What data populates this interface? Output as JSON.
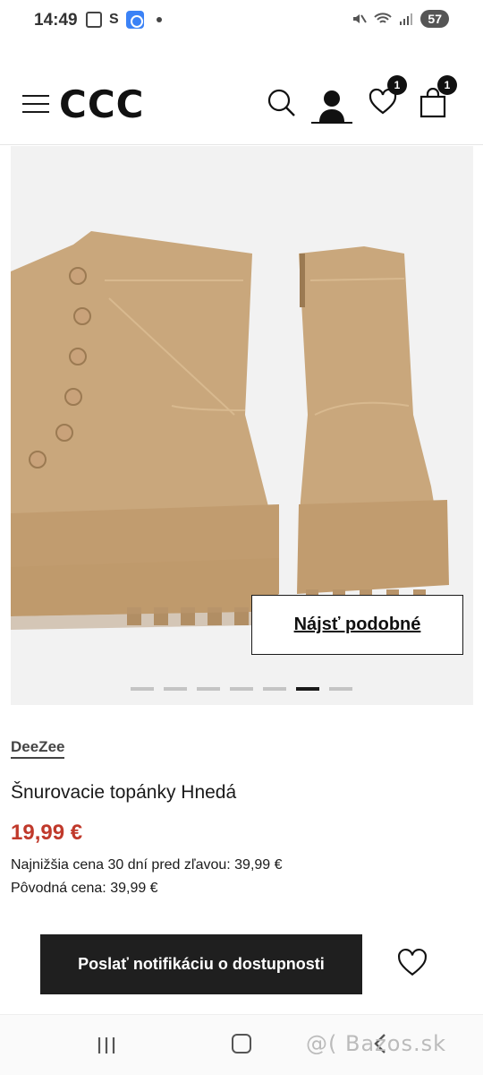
{
  "status_bar": {
    "time": "14:49",
    "battery": "57",
    "carrier_glyph": "S"
  },
  "header": {
    "logo": "CCC",
    "wishlist_count": "1",
    "cart_count": "1"
  },
  "gallery": {
    "similar_button_label": "Nájsť podobné",
    "dot_count": 7,
    "active_dot": 6
  },
  "product": {
    "brand": "DeeZee",
    "title": "Šnurovacie topánky Hnedá",
    "price": "19,99 €",
    "lowest_price_label": "Najnižšia cena 30 dní pred zľavou: 39,99 €",
    "original_price_label": "Pôvodná cena: 39,99 €",
    "notify_button_label": "Poslať notifikáciu o dostupnosti"
  },
  "navbar": {
    "watermark": "@( Bazos.sk"
  },
  "colors": {
    "price": "#c0392b",
    "button_dark": "#1f1f1f",
    "boot": "#c9a77c"
  },
  "icons": [
    "hamburger-icon",
    "search-icon",
    "user-icon",
    "heart-icon",
    "bag-icon",
    "wishlist-heart-icon"
  ]
}
